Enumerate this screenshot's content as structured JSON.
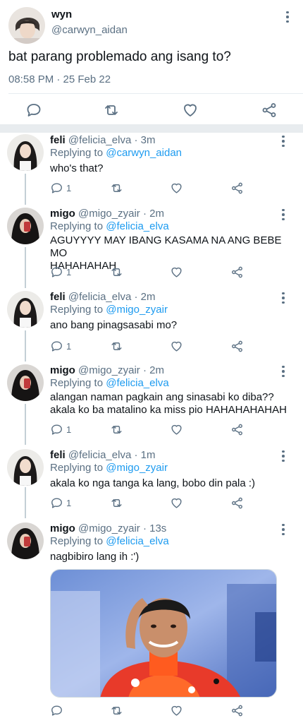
{
  "tweet": {
    "display_name": "wyn",
    "handle": "@carwyn_aidan",
    "text": "bat parang problemado ang isang to?",
    "timestamp": "08:58 PM · 25 Feb 22"
  },
  "replies": [
    {
      "name": "feli",
      "handle": "@felicia_elva",
      "time": "3m",
      "replying_prefix": "Replying to",
      "replying_to": "@carwyn_aidan",
      "text": "who's that?",
      "reply_count": "1"
    },
    {
      "name": "migo",
      "handle": "@migo_zyair",
      "time": "2m",
      "replying_prefix": "Replying to",
      "replying_to": "@felicia_elva",
      "text_line1": "AGUYYYY MAY IBANG KASAMA NA ANG BEBE MO",
      "text_line2": "HAHAHAHAH",
      "reply_count": "1"
    },
    {
      "name": "feli",
      "handle": "@felicia_elva",
      "time": "2m",
      "replying_prefix": "Replying to",
      "replying_to": "@migo_zyair",
      "text": "ano bang pinagsasabi mo?",
      "reply_count": "1"
    },
    {
      "name": "migo",
      "handle": "@migo_zyair",
      "time": "2m",
      "replying_prefix": "Replying to",
      "replying_to": "@felicia_elva",
      "text_line1": "alangan naman pagkain ang sinasabi ko diba??",
      "text_line2": "akala ko ba matalino ka miss pio HAHAHAHAHAH",
      "reply_count": "1"
    },
    {
      "name": "feli",
      "handle": "@felicia_elva",
      "time": "1m",
      "replying_prefix": "Replying to",
      "replying_to": "@migo_zyair",
      "text": "akala ko nga tanga ka lang, bobo din pala :)",
      "reply_count": "1"
    },
    {
      "name": "migo",
      "handle": "@migo_zyair",
      "time": "13s",
      "replying_prefix": "Replying to",
      "replying_to": "@felicia_elva",
      "text": "nagbibiro lang ih :')",
      "reply_count": ""
    }
  ],
  "colors": {
    "link": "#1d9bf0",
    "muted": "#5b7083",
    "text": "#0f1419",
    "separator": "#e8ecef"
  },
  "icons": {
    "reply": "reply-icon",
    "retweet": "retweet-icon",
    "like": "heart-icon",
    "share": "share-icon",
    "more": "more-vertical-icon"
  }
}
